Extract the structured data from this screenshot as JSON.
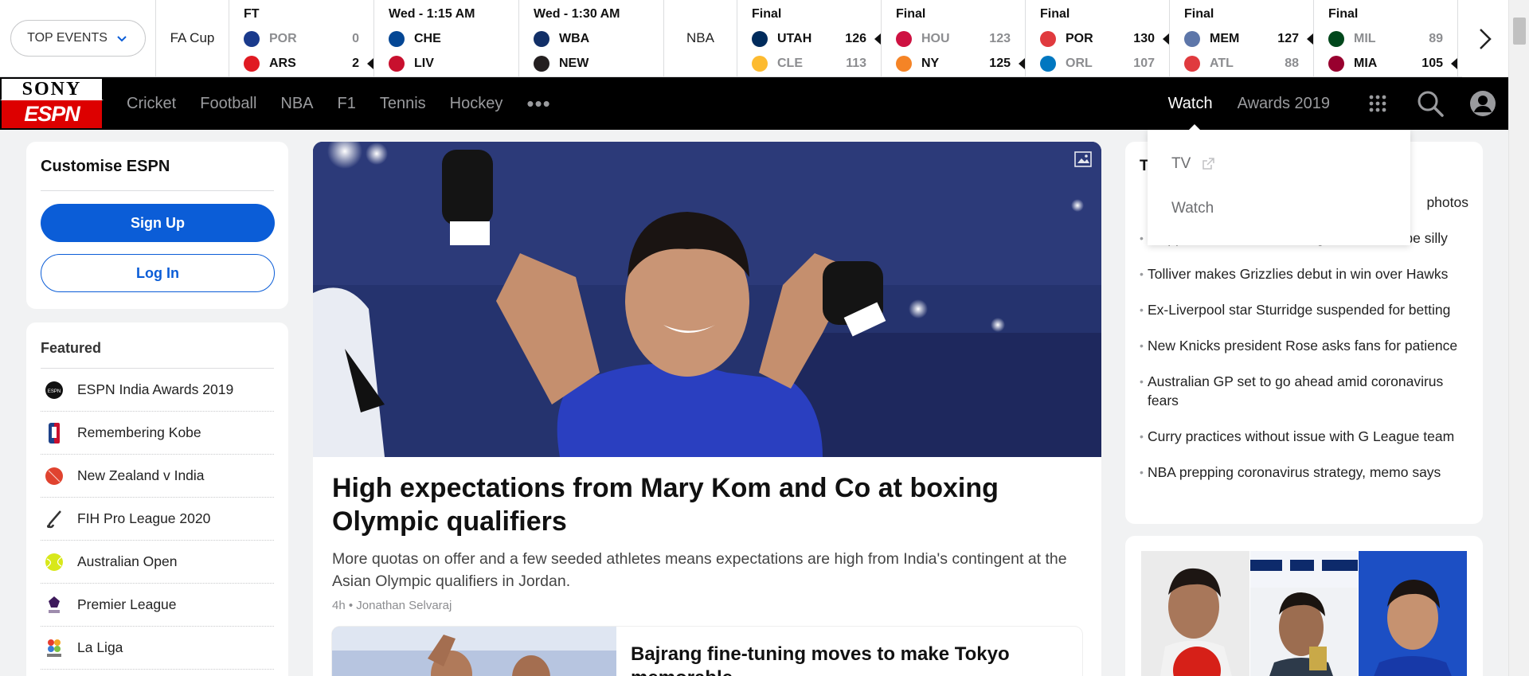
{
  "scores": {
    "top_events_label": "TOP EVENTS",
    "leagues": {
      "fa_cup": "FA Cup",
      "nba": "NBA"
    },
    "fa_games": [
      {
        "status": "FT",
        "home": {
          "team": "POR",
          "score": "0",
          "result": "lose",
          "color": "#1a3a8c"
        },
        "away": {
          "team": "ARS",
          "score": "2",
          "result": "win",
          "color": "#e01a22"
        }
      },
      {
        "status": "Wed  - 1:15 AM",
        "home": {
          "team": "CHE",
          "score": "",
          "result": "win",
          "color": "#034694"
        },
        "away": {
          "team": "LIV",
          "score": "",
          "result": "win",
          "color": "#c8102e"
        }
      },
      {
        "status": "Wed  - 1:30 AM",
        "home": {
          "team": "WBA",
          "score": "",
          "result": "win",
          "color": "#122f67"
        },
        "away": {
          "team": "NEW",
          "score": "",
          "result": "win",
          "color": "#241f20"
        }
      }
    ],
    "nba_games": [
      {
        "status": "Final",
        "home": {
          "team": "UTAH",
          "score": "126",
          "result": "win",
          "color": "#002b5c"
        },
        "away": {
          "team": "CLE",
          "score": "113",
          "result": "lose",
          "color": "#fdbb30"
        }
      },
      {
        "status": "Final",
        "home": {
          "team": "HOU",
          "score": "123",
          "result": "lose",
          "color": "#ce1141"
        },
        "away": {
          "team": "NY",
          "score": "125",
          "result": "win",
          "color": "#f58426"
        }
      },
      {
        "status": "Final",
        "home": {
          "team": "POR",
          "score": "130",
          "result": "win",
          "color": "#e03a3e"
        },
        "away": {
          "team": "ORL",
          "score": "107",
          "result": "lose",
          "color": "#0077c0"
        }
      },
      {
        "status": "Final",
        "home": {
          "team": "MEM",
          "score": "127",
          "result": "win",
          "color": "#5d76a9"
        },
        "away": {
          "team": "ATL",
          "score": "88",
          "result": "lose",
          "color": "#e03a3e"
        }
      },
      {
        "status": "Final",
        "home": {
          "team": "MIL",
          "score": "89",
          "result": "lose",
          "color": "#00471b"
        },
        "away": {
          "team": "MIA",
          "score": "105",
          "result": "win",
          "color": "#98002e"
        }
      }
    ]
  },
  "nav": {
    "logo_top": "SONY",
    "logo_bottom": "ESPN",
    "links": [
      "Cricket",
      "Football",
      "NBA",
      "F1",
      "Tennis",
      "Hockey"
    ],
    "more": "•••",
    "watch": "Watch",
    "awards": "Awards 2019"
  },
  "dropdown": {
    "items": [
      "TV",
      "Watch"
    ]
  },
  "customise": {
    "title": "Customise ESPN",
    "signup": "Sign Up",
    "login": "Log In"
  },
  "featured": {
    "title": "Featured",
    "items": [
      {
        "label": "ESPN India Awards 2019",
        "icon": "awards-icon"
      },
      {
        "label": "Remembering Kobe",
        "icon": "nba-icon"
      },
      {
        "label": "New Zealand v India",
        "icon": "cricket-ball-icon"
      },
      {
        "label": "FIH Pro League 2020",
        "icon": "hockey-stick-icon"
      },
      {
        "label": "Australian Open",
        "icon": "tennis-ball-icon"
      },
      {
        "label": "Premier League",
        "icon": "premier-league-icon"
      },
      {
        "label": "La Liga",
        "icon": "laliga-icon"
      }
    ]
  },
  "article": {
    "title": "High expectations from Mary Kom and Co at boxing Olympic qualifiers",
    "description": "More quotas on offer and a few seeded athletes means expectations are high from India's contingent at the Asian Olympic qualifiers in Jordan.",
    "meta": "4h • Jonathan Selvaraj",
    "sub_title": "Bajrang fine-tuning moves to make Tokyo memorable"
  },
  "news": {
    "title": "T",
    "items": [
      "photos",
      "Klopp on coronavirus ending Prem: Don't be silly",
      "Tolliver makes Grizzlies debut in win over Hawks",
      "Ex-Liverpool star Sturridge suspended for betting",
      "New Knicks president Rose asks fans for patience",
      "Australian GP set to go ahead amid coronavirus fears",
      "Curry practices without issue with G League team",
      "NBA prepping coronavirus strategy, memo says"
    ]
  },
  "colors": {
    "accent_blue": "#0b5dd7",
    "espn_red": "#dd0000",
    "nav_bg": "#000000"
  }
}
